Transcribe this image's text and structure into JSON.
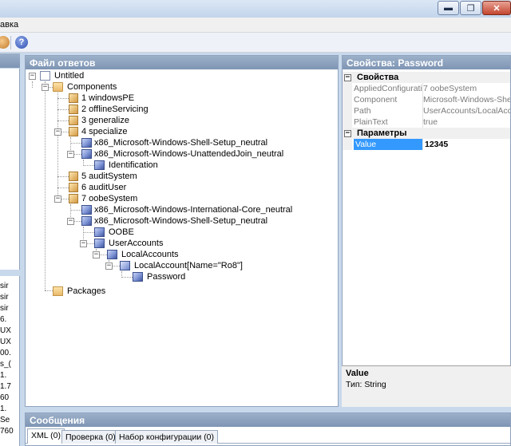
{
  "window": {
    "menu_fragment": "авка",
    "min_glyph": "▬",
    "max_glyph": "❐",
    "close_glyph": "✕"
  },
  "toolbar": {
    "help_glyph": "?"
  },
  "left_fragments": [
    "sir",
    "sir",
    "sir",
    "6.",
    "UX",
    "UX",
    "00.",
    "s_(",
    "1.",
    "1.7",
    "60",
    "1.",
    "Se",
    "760"
  ],
  "answer_file": {
    "title": "Файл ответов",
    "tree": {
      "root": "Untitled",
      "components": "Components",
      "p1": "1 windowsPE",
      "p2": "2 offlineServicing",
      "p3": "3 generalize",
      "p4": "4 specialize",
      "p4_c1": "x86_Microsoft-Windows-Shell-Setup_neutral",
      "p4_c2": "x86_Microsoft-Windows-UnattendedJoin_neutral",
      "p4_c2_c1": "Identification",
      "p5": "5 auditSystem",
      "p6": "6 auditUser",
      "p7": "7 oobeSystem",
      "p7_c1": "x86_Microsoft-Windows-International-Core_neutral",
      "p7_c2": "x86_Microsoft-Windows-Shell-Setup_neutral",
      "oobe": "OOBE",
      "user_accounts": "UserAccounts",
      "local_accounts": "LocalAccounts",
      "local_account": "LocalAccount[Name=\"Ro8\"]",
      "password": "Password",
      "packages": "Packages"
    }
  },
  "properties": {
    "title": "Свойства: Password",
    "cat1": "Свойства",
    "rows1": [
      {
        "key": "AppliedConfiguratio",
        "value": "7 oobeSystem"
      },
      {
        "key": "Component",
        "value": "Microsoft-Windows-Shell-Se"
      },
      {
        "key": "Path",
        "value": "UserAccounts/LocalAccou"
      },
      {
        "key": "PlainText",
        "value": "true"
      }
    ],
    "cat2": "Параметры",
    "rows2": [
      {
        "key": "Value",
        "value": "12345"
      }
    ],
    "desc_title": "Value",
    "desc_text": "Тип: String"
  },
  "messages": {
    "title": "Сообщения",
    "tabs": [
      "XML (0)",
      "Проверка (0)",
      "Набор конфигурации (0)"
    ]
  }
}
